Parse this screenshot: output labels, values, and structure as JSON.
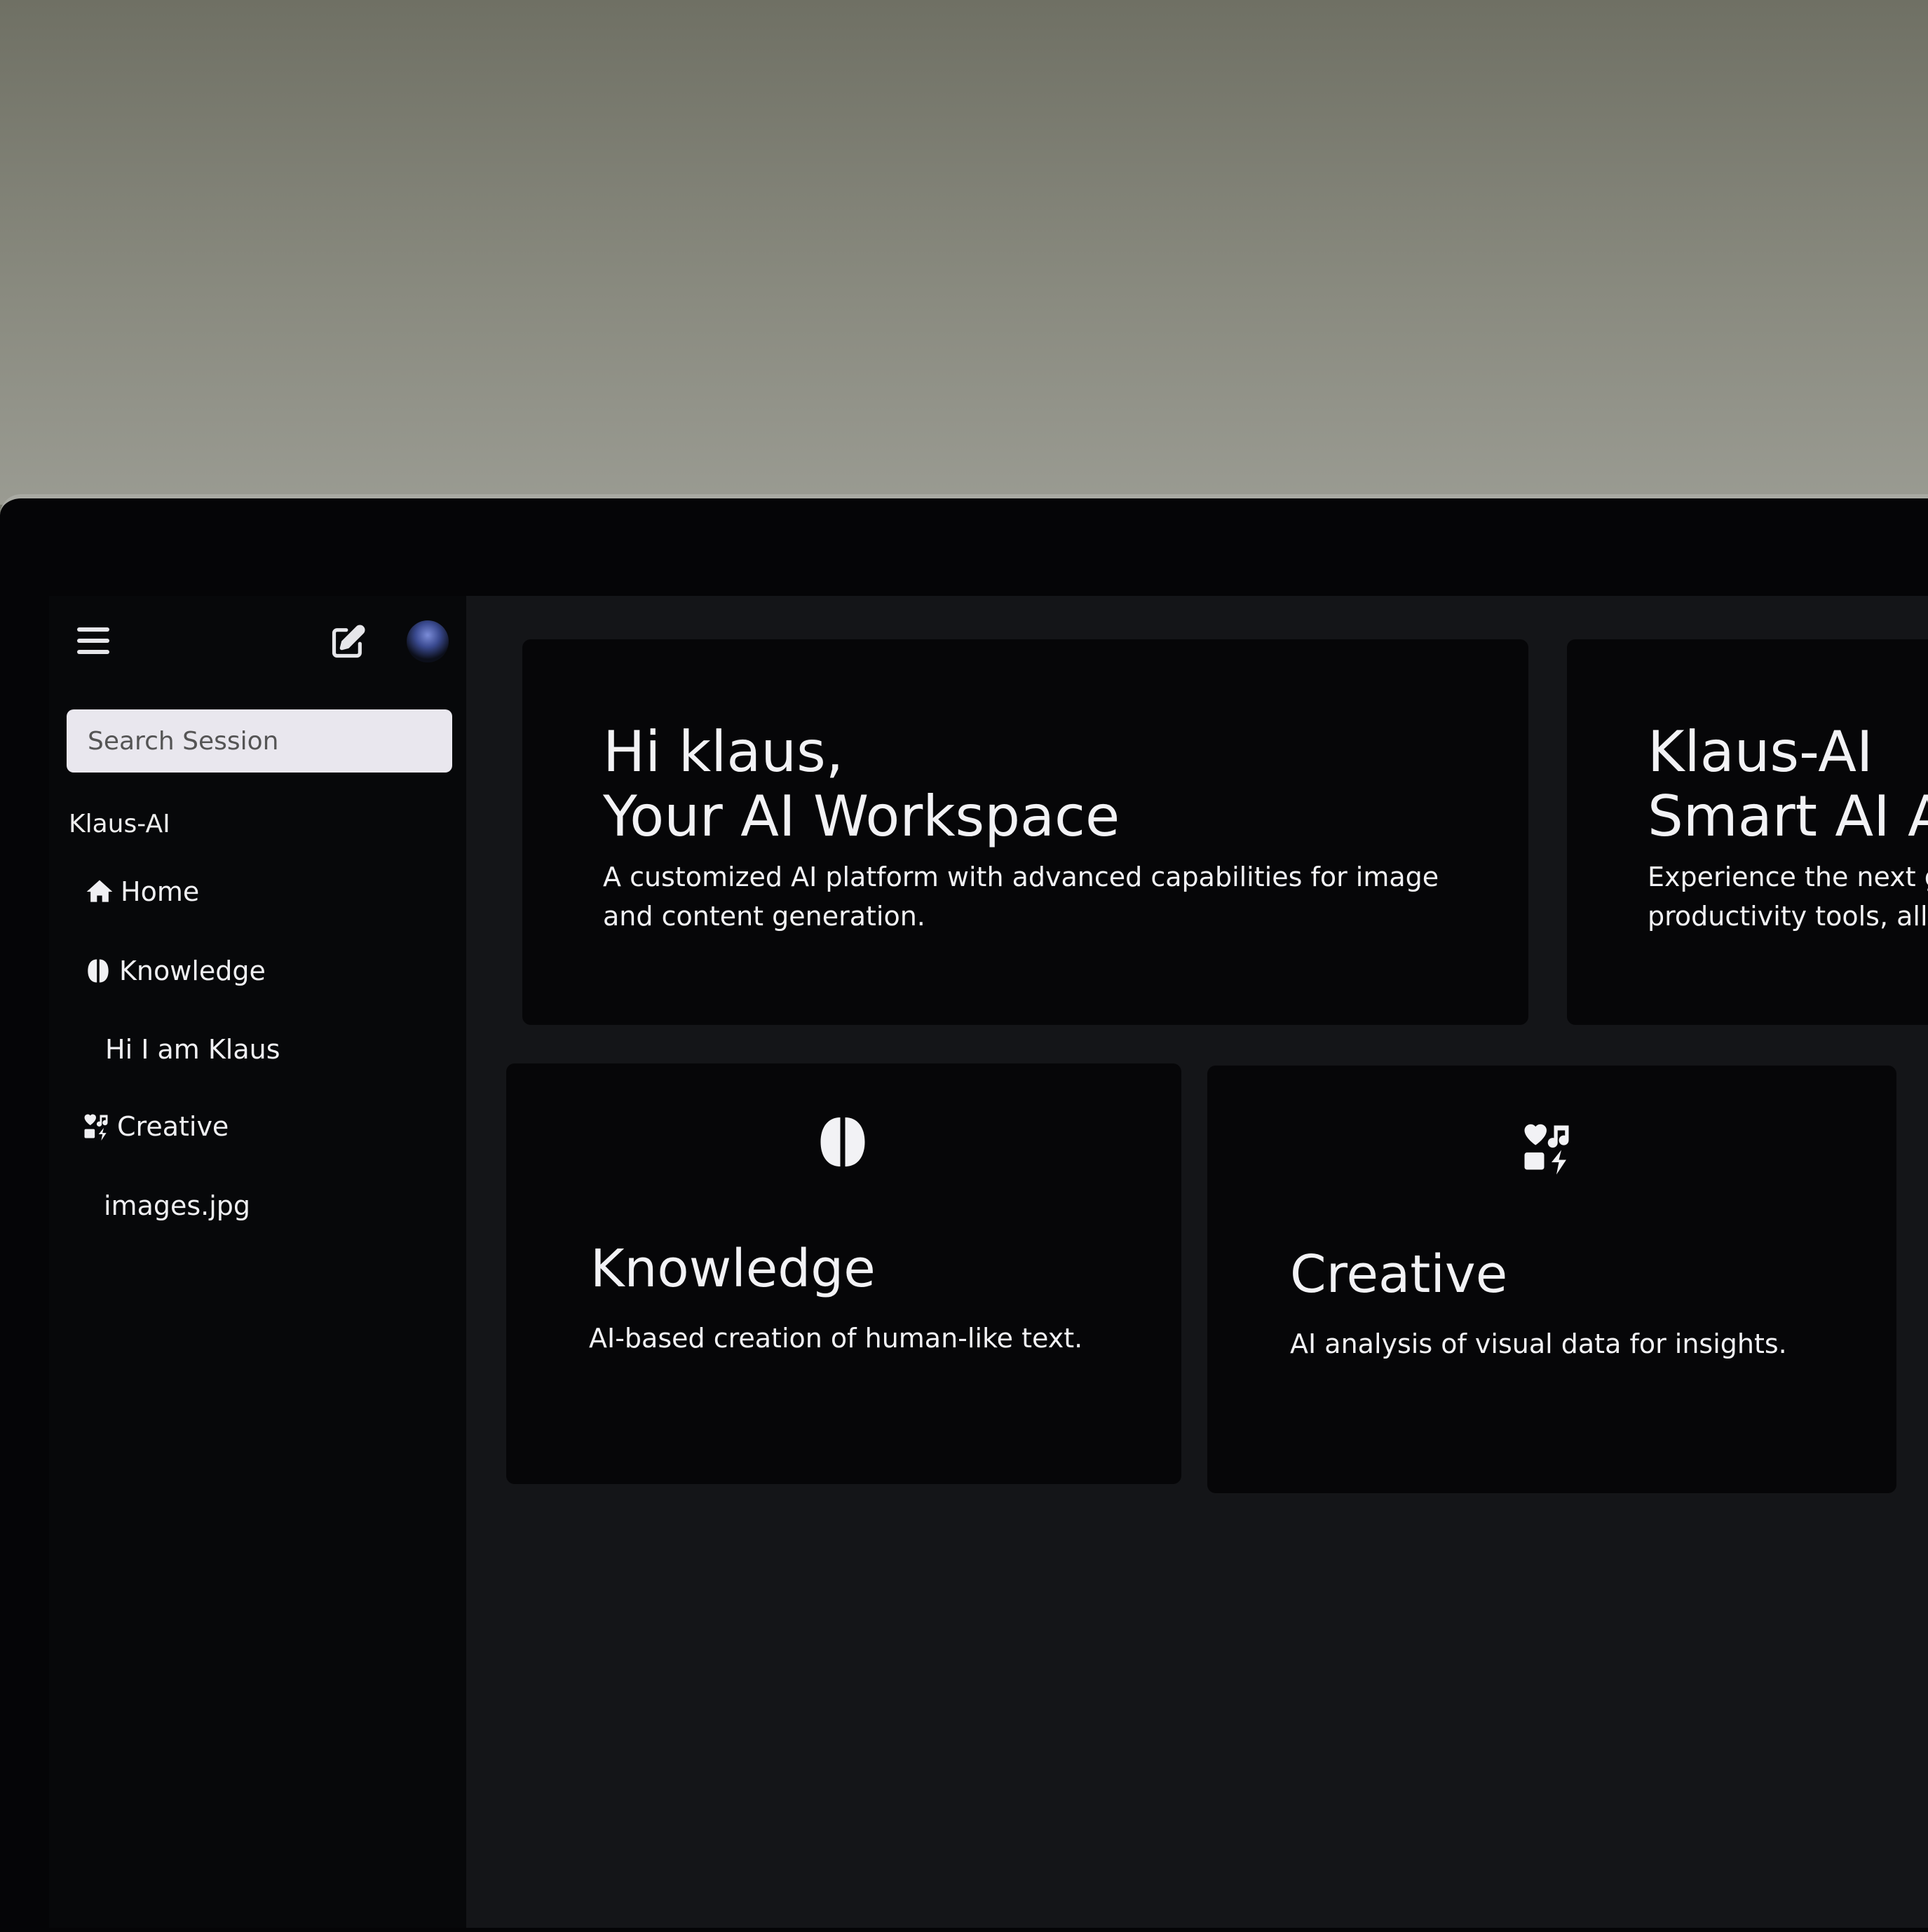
{
  "sidebar": {
    "search_placeholder": "Search Session",
    "section_title": "Klaus-AI",
    "items": [
      {
        "label": "Home",
        "icon": "home-icon"
      },
      {
        "label": "Knowledge",
        "icon": "brain-icon"
      },
      {
        "label": "Hi I am Klaus"
      },
      {
        "label": "Creative",
        "icon": "creative-icon"
      },
      {
        "label": "images.jpg"
      }
    ]
  },
  "hero": {
    "title_line1": "Hi klaus,",
    "title_line2": "Your AI Workspace",
    "sub_line1": "A customized AI platform with advanced capabilities for image",
    "sub_line2": "and content generation."
  },
  "hero2": {
    "title_line1": "Klaus-AI",
    "title_line2": "Smart AI A",
    "sub_line1": "Experience the next g",
    "sub_line2": "productivity tools, all"
  },
  "features": [
    {
      "title": "Knowledge",
      "description": "AI-based creation of human-like text.",
      "icon": "brain-icon"
    },
    {
      "title": "Creative",
      "description": "AI analysis of visual data for insights.",
      "icon": "creative-icon"
    }
  ]
}
